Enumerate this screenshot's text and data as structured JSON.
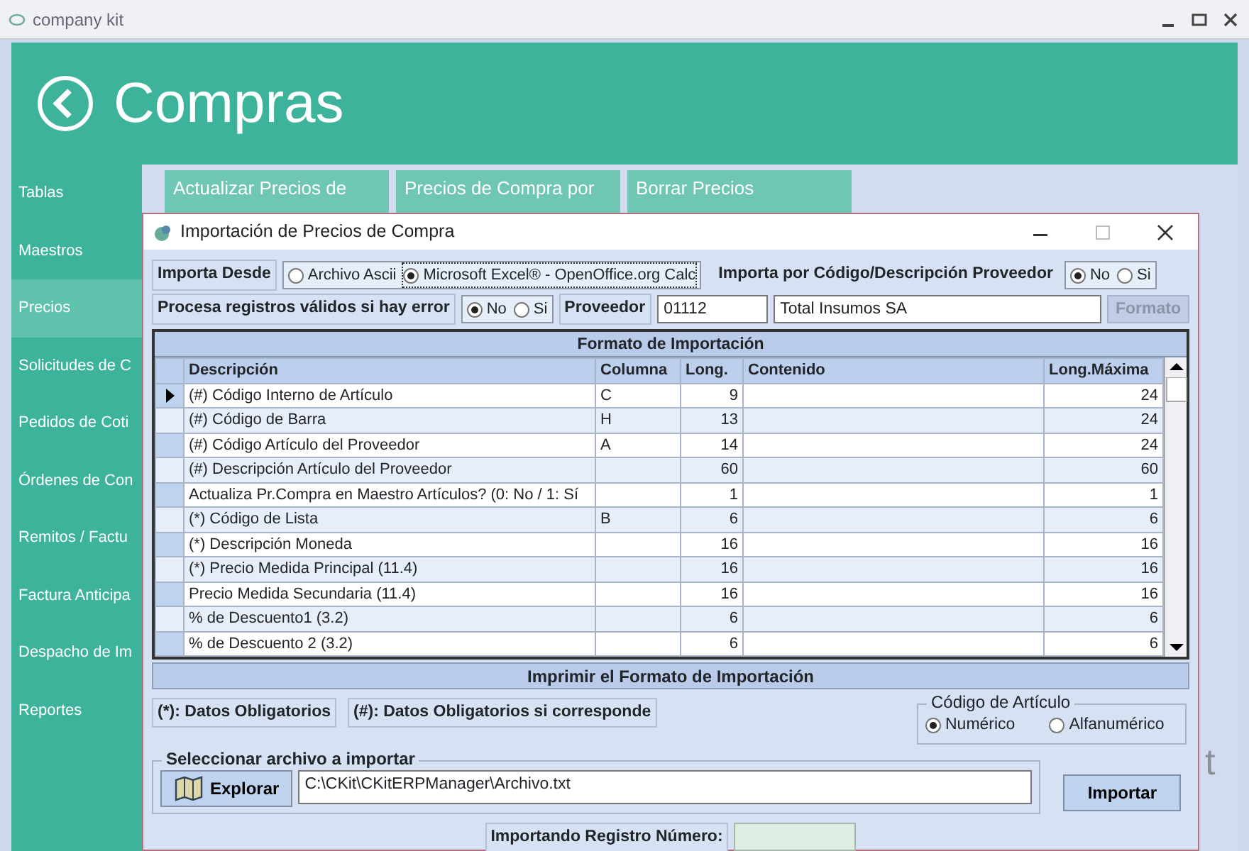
{
  "window": {
    "title": "company kit"
  },
  "header": {
    "title": "Compras"
  },
  "sidebar": {
    "items": [
      {
        "label": "Tablas",
        "selected": false
      },
      {
        "label": "Maestros",
        "selected": false
      },
      {
        "label": "Precios",
        "selected": true
      },
      {
        "label": "Solicitudes de C",
        "selected": false
      },
      {
        "label": "Pedidos de Coti",
        "selected": false
      },
      {
        "label": "Órdenes de Con",
        "selected": false
      },
      {
        "label": "Remitos / Factu",
        "selected": false
      },
      {
        "label": "Factura Anticipa",
        "selected": false
      },
      {
        "label": "Despacho de Im",
        "selected": false
      },
      {
        "label": "Reportes",
        "selected": false
      }
    ]
  },
  "tiles": [
    {
      "label": "Actualizar Precios de"
    },
    {
      "label": "Precios de Compra por"
    },
    {
      "label": "Borrar Precios"
    }
  ],
  "logo_fragment": "t",
  "dialog": {
    "title": "Importación de Precios de Compra",
    "import_from": {
      "label": "Importa Desde",
      "options": [
        {
          "label": "Archivo Ascii",
          "selected": false
        },
        {
          "label": "Microsoft Excel® - OpenOffice.org Calc",
          "selected": true
        }
      ]
    },
    "import_by_code": {
      "label": "Importa por Código/Descripción Proveedor",
      "options": [
        {
          "label": "No",
          "selected": true
        },
        {
          "label": "Si",
          "selected": false
        }
      ]
    },
    "process_errors": {
      "label": "Procesa registros válidos si hay error",
      "options": [
        {
          "label": "No",
          "selected": true
        },
        {
          "label": "Si",
          "selected": false
        }
      ]
    },
    "supplier": {
      "label": "Proveedor",
      "code": "01112",
      "name": "Total Insumos SA"
    },
    "format_button": {
      "label": "Formato",
      "disabled": true
    },
    "grid": {
      "title": "Formato de Importación",
      "columns": [
        "Descripción",
        "Columna",
        "Long.",
        "Contenido",
        "Long.Máxima"
      ],
      "rows": [
        {
          "cells": [
            "(#) Código Interno de Artículo",
            "C",
            "9",
            "",
            "24"
          ],
          "current": true
        },
        {
          "cells": [
            "(#) Código de Barra",
            "H",
            "13",
            "",
            "24"
          ],
          "current": false
        },
        {
          "cells": [
            "(#) Código Artículo del Proveedor",
            "A",
            "14",
            "",
            "24"
          ],
          "current": false
        },
        {
          "cells": [
            "(#) Descripción Artículo del Proveedor",
            "",
            "60",
            "",
            "60"
          ],
          "current": false
        },
        {
          "cells": [
            "Actualiza Pr.Compra en Maestro Artículos? (0: No / 1: Sí",
            "",
            "1",
            "",
            "1"
          ],
          "current": false
        },
        {
          "cells": [
            "(*) Código de Lista",
            "B",
            "6",
            "",
            "6"
          ],
          "current": false
        },
        {
          "cells": [
            "(*) Descripción Moneda",
            "",
            "16",
            "",
            "16"
          ],
          "current": false
        },
        {
          "cells": [
            "(*) Precio Medida Principal (11.4)",
            "",
            "16",
            "",
            "16"
          ],
          "current": false
        },
        {
          "cells": [
            "Precio Medida Secundaria (11.4)",
            "",
            "16",
            "",
            "16"
          ],
          "current": false
        },
        {
          "cells": [
            "% de Descuento1 (3.2)",
            "",
            "6",
            "",
            "6"
          ],
          "current": false
        },
        {
          "cells": [
            "% de Descuento 2 (3.2)",
            "",
            "6",
            "",
            "6"
          ],
          "current": false
        }
      ]
    },
    "print_button": {
      "label": "Imprimir el Formato de Importación"
    },
    "legend": [
      "(*): Datos Obligatorios",
      "(#): Datos Obligatorios si corresponde"
    ],
    "article_code": {
      "label": "Código de Artículo",
      "options": [
        {
          "label": "Numérico",
          "selected": true
        },
        {
          "label": "Alfanumérico",
          "selected": false
        }
      ]
    },
    "file": {
      "label": "Seleccionar archivo a importar",
      "browse": "Explorar",
      "path": "C:\\CKit\\CKitERPManager\\Archivo.txt"
    },
    "import_button": {
      "label": "Importar"
    },
    "progress": {
      "label": "Importando Registro Número:"
    }
  }
}
